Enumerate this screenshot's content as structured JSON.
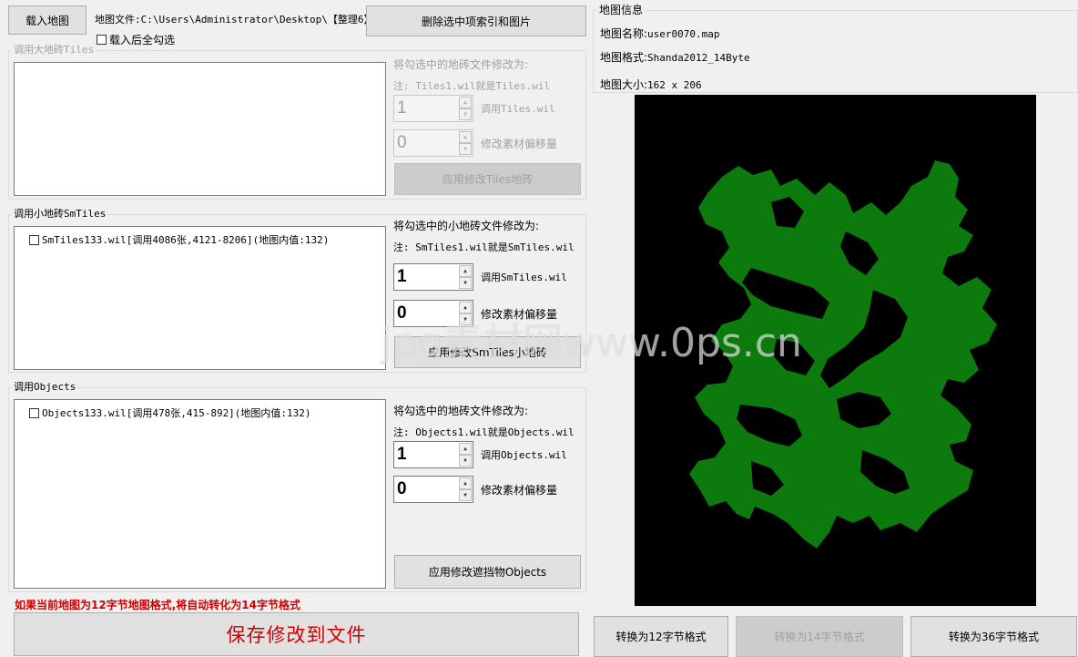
{
  "toolbar": {
    "load_map": "载入地图",
    "map_file_label": "地图文件:C:\\Users\\Administrator\\Desktop\\【整理6】:",
    "delete_selected": "删除选中项索引和图片",
    "check_all_after_load": "载入后全勾选"
  },
  "tiles": {
    "title": "调用大地砖Tiles",
    "modify_label": "将勾选中的地砖文件修改为:",
    "note": "注: Tiles1.wil就是Tiles.wil",
    "file_index": {
      "value": "1",
      "label": "调用Tiles.wil"
    },
    "offset": {
      "value": "0",
      "label": "修改素材偏移量"
    },
    "apply": "应用修改Tiles地砖",
    "items": []
  },
  "smtiles": {
    "title": "调用小地砖SmTiles",
    "modify_label": "将勾选中的小地砖文件修改为:",
    "note": "注: SmTiles1.wil就是SmTiles.wil",
    "file_index": {
      "value": "1",
      "label": "调用SmTiles.wil"
    },
    "offset": {
      "value": "0",
      "label": "修改素材偏移量"
    },
    "apply": "应用修改SmTiles小地砖",
    "items": [
      {
        "label": "SmTiles133.wil[调用4086张,4121-8206](地图内值:132)",
        "checked": false
      }
    ]
  },
  "objects": {
    "title": "调用Objects",
    "modify_label": "将勾选中的地砖文件修改为:",
    "note": "注: Objects1.wil就是Objects.wil",
    "file_index": {
      "value": "1",
      "label": "调用Objects.wil"
    },
    "offset": {
      "value": "0",
      "label": "修改素材偏移量"
    },
    "apply": "应用修改遮挡物Objects",
    "items": [
      {
        "label": "Objects133.wil[调用478张,415-892](地图内值:132)",
        "checked": false
      }
    ]
  },
  "notice": "如果当前地图为12字节地图格式,将自动转化为14字节格式",
  "save_button": "保存修改到文件",
  "map_info": {
    "title": "地图信息",
    "name_label": "地图名称:",
    "name_value": "user0070.map",
    "format_label": "地图格式:",
    "format_value": "Shanda2012_14Byte",
    "size_label": "地图大小:",
    "size_value": "162 x 206"
  },
  "convert": {
    "to12": "转换为12字节格式",
    "to14": "转换为14字节格式",
    "to36": "转换为36字节格式"
  },
  "watermark": "jpg素材网www.0ps.cn",
  "colors": {
    "map_bg": "#000000",
    "map_walkable": "#0c7a0c",
    "notice_red": "#d00000"
  }
}
